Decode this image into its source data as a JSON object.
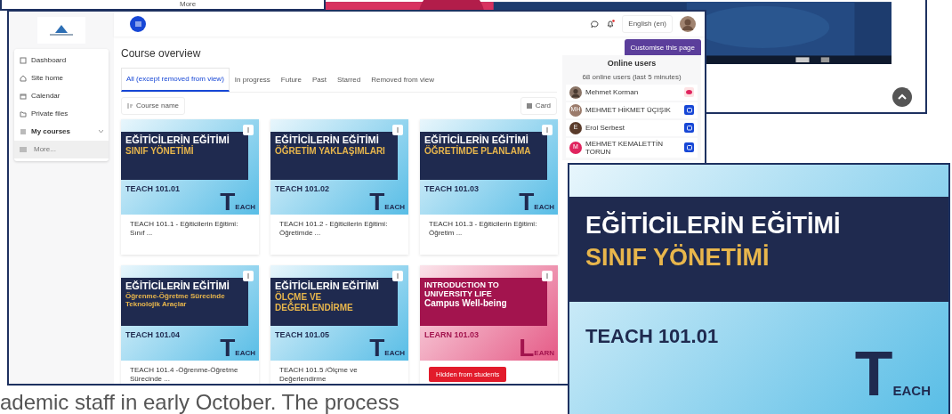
{
  "back_window": {
    "menu_item": "More"
  },
  "video_window": {
    "scroll_top": true
  },
  "main_window": {
    "sidebar": {
      "items": [
        {
          "label": "Dashboard",
          "bold": false,
          "expandable": false
        },
        {
          "label": "Site home",
          "bold": false,
          "expandable": false
        },
        {
          "label": "Calendar",
          "bold": false,
          "expandable": false
        },
        {
          "label": "Private files",
          "bold": false,
          "expandable": false
        },
        {
          "label": "My courses",
          "bold": true,
          "expandable": true
        }
      ],
      "more": "More..."
    },
    "topbar": {
      "notifications_unread": true,
      "language": "English (en)"
    },
    "heading": "Course overview",
    "tabs": [
      {
        "label": "All (except removed from view)",
        "selected": true
      },
      {
        "label": "In progress",
        "selected": false
      },
      {
        "label": "Future",
        "selected": false
      },
      {
        "label": "Past",
        "selected": false
      },
      {
        "label": "Starred",
        "selected": false
      },
      {
        "label": "Removed from view",
        "selected": false
      }
    ],
    "sort": "Course name",
    "view": "Card",
    "courses": [
      {
        "kind": "teach",
        "title": "EĞİTİCİLERİN EĞİTİMİ",
        "subtitle": "SINIF YÖNETİMİ",
        "code": "TEACH 101.01",
        "logo_letter": "T",
        "logo_rest": "EACH",
        "name": "TEACH 101.1 - Eğiticilerin Eğitimi: Sınıf ..."
      },
      {
        "kind": "teach",
        "title": "EĞİTİCİLERİN EĞİTİMİ",
        "subtitle": "ÖĞRETİM YAKLAŞIMLARI",
        "code": "TEACH 101.02",
        "logo_letter": "T",
        "logo_rest": "EACH",
        "name": "TEACH 101.2 - Eğiticilerin Eğitimi: Öğretimde ..."
      },
      {
        "kind": "teach",
        "title": "EĞİTİCİLERİN EĞİTİMİ",
        "subtitle": "ÖĞRETİMDE PLANLAMA",
        "code": "TEACH 101.03",
        "logo_letter": "T",
        "logo_rest": "EACH",
        "name": "TEACH 101.3 - Eğiticilerin Eğitimi: Öğretim ..."
      },
      {
        "kind": "teach",
        "title": "EĞİTİCİLERİN EĞİTİMİ",
        "subtitle": "Öğrenme-Öğretme Sürecinde Teknolojik Araçlar",
        "code": "TEACH 101.04",
        "logo_letter": "T",
        "logo_rest": "EACH",
        "name": "TEACH 101.4 -Öğrenme-Öğretme Sürecinde ..."
      },
      {
        "kind": "teach",
        "title": "EĞİTİCİLERİN EĞİTİMİ",
        "subtitle": "ÖLÇME VE DEĞERLENDİRME",
        "code": "TEACH 101.05",
        "logo_letter": "T",
        "logo_rest": "EACH",
        "name": "TEACH 101.5 /Ölçme ve Değerlendirme"
      },
      {
        "kind": "learn",
        "title": "INTRODUCTION TO UNIVERSITY LIFE",
        "subtitle": "Campus Well-being",
        "code": "LEARN 101.03",
        "logo_letter": "L",
        "logo_rest": "EARN",
        "badge": "Hidden from students"
      }
    ],
    "customise_button": "Customise this page",
    "online_users": {
      "title": "Online users",
      "count": "68 online users (last 5 minutes)",
      "users": [
        {
          "kind": "hide",
          "name": "Mehmet Korman",
          "color": "#8a7466"
        },
        {
          "kind": "message",
          "name": "MEHMET HİKMET ÜÇIŞIK",
          "initials": "MH",
          "color": "#9b7b6b"
        },
        {
          "kind": "message",
          "name": "Erol Serbest",
          "initials": "E",
          "color": "#5a3b2b"
        },
        {
          "kind": "message",
          "name": "MEHMET KEMALETTİN TORUN",
          "initials": "M",
          "color": "#e0245e"
        }
      ]
    }
  },
  "zoomed_card": {
    "kind": "teach",
    "title": "EĞİTİCİLERİN EĞİTİMİ",
    "subtitle": "SINIF YÖNETİMİ",
    "code": "TEACH 101.01",
    "logo_letter": "T",
    "logo_rest": "EACH"
  },
  "caption": "ademic staff in early October. The process"
}
